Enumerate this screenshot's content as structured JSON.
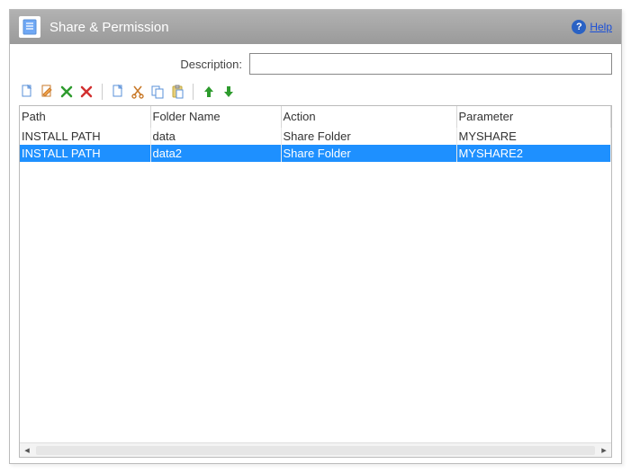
{
  "title": "Share & Permission",
  "help": {
    "label": "Help"
  },
  "description": {
    "label": "Description:",
    "value": ""
  },
  "toolbar": {
    "new": "new",
    "edit": "edit",
    "delete": "delete",
    "delete_all": "delete-all",
    "copy": "copy",
    "cut": "cut",
    "duplicate": "duplicate",
    "paste": "paste",
    "move_up": "move-up",
    "move_down": "move-down"
  },
  "columns": {
    "c0": "Path",
    "c1": "Folder Name",
    "c2": "Action",
    "c3": "Parameter"
  },
  "rows": [
    {
      "path": "INSTALL PATH",
      "folder": "data",
      "action": "Share Folder",
      "param": "MYSHARE",
      "selected": false
    },
    {
      "path": "INSTALL PATH",
      "folder": "data2",
      "action": "Share Folder",
      "param": "MYSHARE2",
      "selected": true
    }
  ]
}
